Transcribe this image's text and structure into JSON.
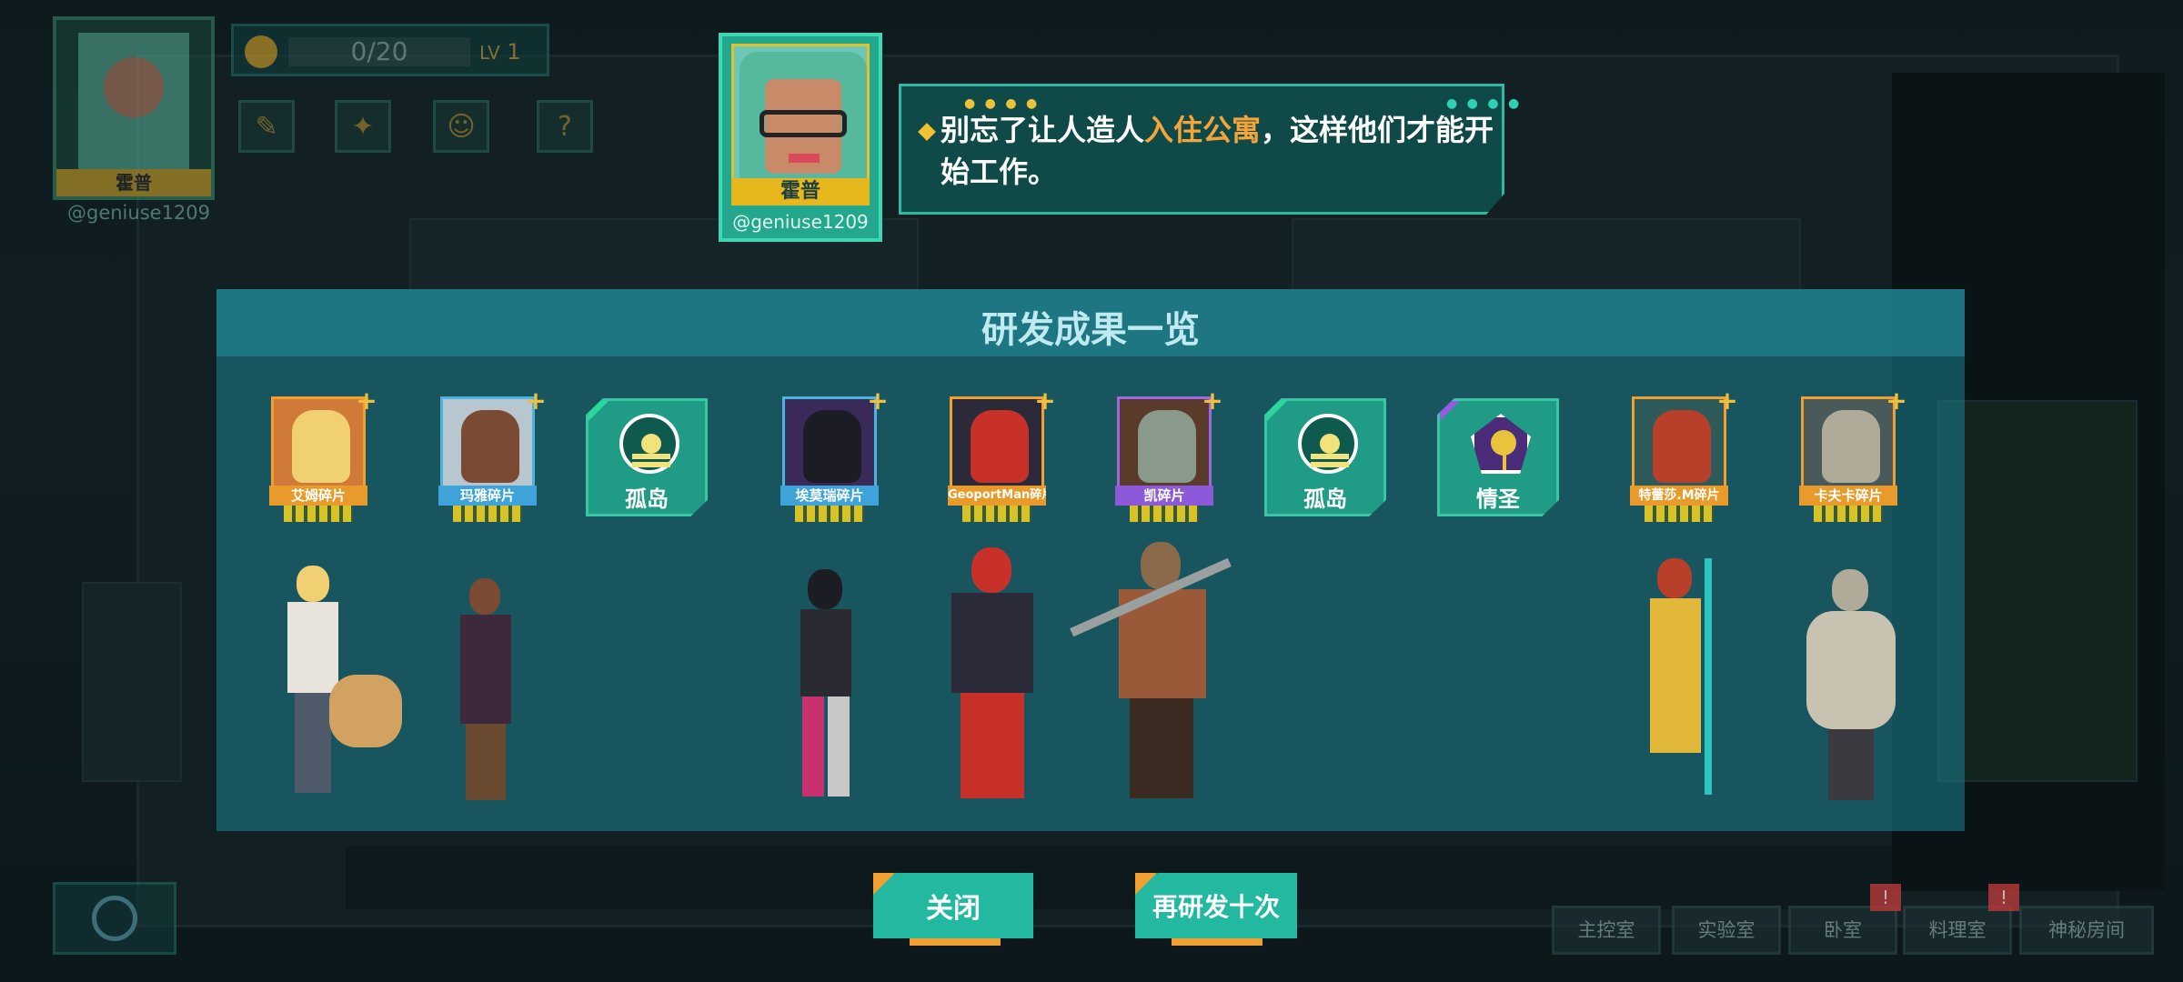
{
  "player": {
    "name": "霍普",
    "handle": "@geniuse1209",
    "exp": "0/20",
    "level_prefix": "LV",
    "level": "1"
  },
  "quick_buttons": [
    {
      "icon": "note-icon",
      "glyph": "✎"
    },
    {
      "icon": "flashlight-icon",
      "glyph": "✦"
    },
    {
      "icon": "smile-icon",
      "glyph": "☺"
    },
    {
      "icon": "help-icon",
      "glyph": "?"
    }
  ],
  "npc": {
    "name": "霍普",
    "handle": "@geniuse1209"
  },
  "dialogue": {
    "before": "别忘了让人造人",
    "highlight": "入住公寓",
    "after": "，这样他们才能开始工作。",
    "highlight_color": "#f5a43a"
  },
  "results": {
    "title": "研发成果一览",
    "items": [
      {
        "kind": "character",
        "label": "艾姆碎片",
        "rarity": "orange"
      },
      {
        "kind": "character",
        "label": "玛雅碎片",
        "rarity": "blue"
      },
      {
        "kind": "tile",
        "label": "孤岛",
        "icon": "island-icon"
      },
      {
        "kind": "character",
        "label": "埃莫瑞碎片",
        "rarity": "blue"
      },
      {
        "kind": "character",
        "label": "GeoportMan碎片",
        "rarity": "orange"
      },
      {
        "kind": "character",
        "label": "凯碎片",
        "rarity": "purple"
      },
      {
        "kind": "tile",
        "label": "孤岛",
        "icon": "island-icon"
      },
      {
        "kind": "tile",
        "label": "情圣",
        "icon": "rose-icon"
      },
      {
        "kind": "character",
        "label": "特蕾莎.M碎片",
        "rarity": "orange"
      },
      {
        "kind": "character",
        "label": "卡夫卡碎片",
        "rarity": "orange"
      }
    ]
  },
  "buttons": {
    "close": "关闭",
    "research_again": "再研发十次"
  },
  "nav": {
    "tabs": [
      "主控室",
      "实验室",
      "卧室",
      "料理室",
      "神秘房间"
    ],
    "alert_glyph": "!"
  },
  "colors": {
    "accent_teal": "#22b9a0",
    "accent_orange": "#f0a030",
    "panel": "#1c7682"
  }
}
